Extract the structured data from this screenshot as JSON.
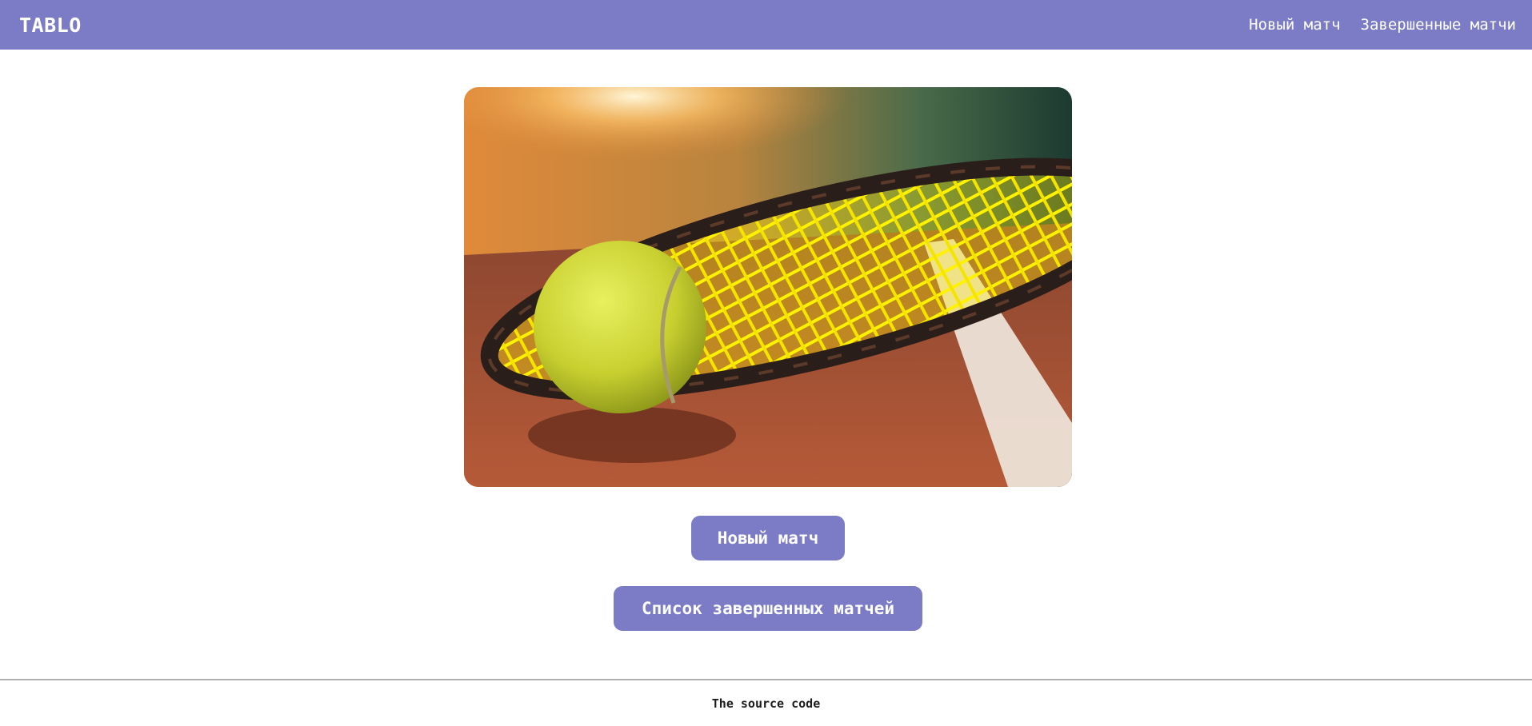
{
  "header": {
    "brand": "TABLO",
    "nav": [
      {
        "label": "Новый матч"
      },
      {
        "label": "Завершенные матчи"
      }
    ]
  },
  "hero": {
    "image": "tennis-racket-and-ball-on-clay-court"
  },
  "actions": {
    "new_match_label": "Новый матч",
    "finished_list_label": "Список завершенных матчей"
  },
  "footer": {
    "source_link_label": "The source code"
  },
  "colors": {
    "accent": "#7b7bc6",
    "background": "#ffffff",
    "footer_rule": "#b0b0b0"
  }
}
